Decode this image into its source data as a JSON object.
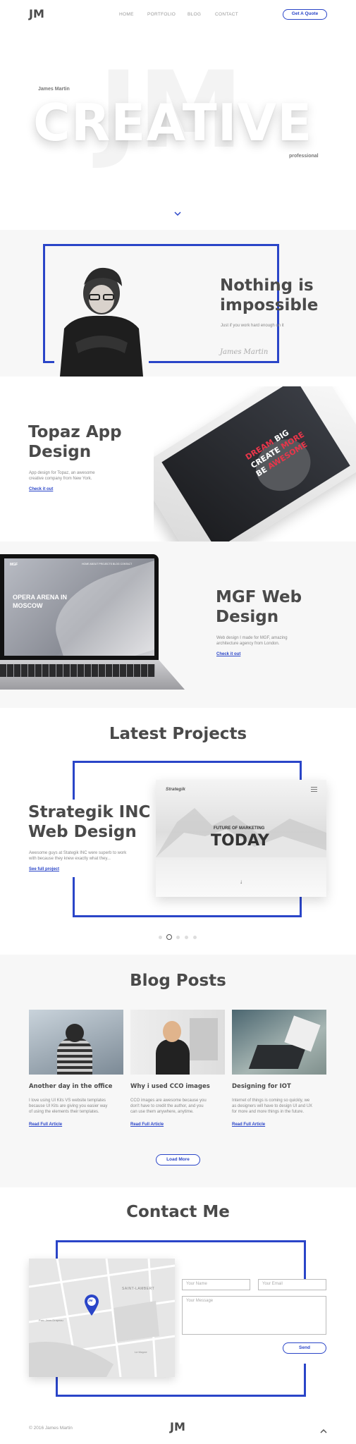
{
  "header": {
    "logo": "JM",
    "nav": [
      "HOME",
      "PORTFOLIO",
      "BLOG",
      "CONTACT"
    ],
    "cta": "Get A Quote"
  },
  "hero": {
    "name": "James Martin",
    "watermark": "JM",
    "title": "CREATIVE",
    "tagline": "professional"
  },
  "intro": {
    "heading_line1": "Nothing is",
    "heading_line2": "impossible",
    "text": "Just if you work hard enough on it",
    "signature": "James Martin"
  },
  "topaz": {
    "title_line1": "Topaz App",
    "title_line2": "Design",
    "desc_line1": "App design for Topaz, an awesome",
    "desc_line2": "creative company from New York.",
    "link": "Check it out",
    "phone_line1a": "DREAM ",
    "phone_line1b": "BIG",
    "phone_line2a": "CREATE ",
    "phone_line2b": "MORE",
    "phone_line3a": "BE ",
    "phone_line3b": "AWESOME"
  },
  "mgf": {
    "title_line1": "MGF Web",
    "title_line2": "Design",
    "desc_line1": "Web design I made for MGF, amazing",
    "desc_line2": "architecture agency from London.",
    "link": "Check it out",
    "screen_logo": "MGF",
    "screen_nav": "HOME  ABOUT  PROJECTS  BLOG  CONTACT",
    "screen_line1": "OPERA ARENA IN",
    "screen_line2": "MOSCOW"
  },
  "projects": {
    "heading": "Latest Projects",
    "title_line1": "Strategik INC",
    "title_line2": "Web Design",
    "desc_line1": "Awesome guys at Stategik INC were superb to work",
    "desc_line2": "with because they knew exactly what they...",
    "link": "See full project",
    "card_brand": "Strategik",
    "card_kicker": "FUTURE OF MARKETING",
    "card_title": "TODAY",
    "slides": 5,
    "active_slide": 2
  },
  "blog": {
    "heading": "Blog Posts",
    "posts": [
      {
        "title": "Another day in the office",
        "line1": "I love using UI Kits VS website templates",
        "line2": "because UI Kits are giving you easier way",
        "line3": "of using the elements their templates.",
        "link": "Read Full Article"
      },
      {
        "title": "Why i used CCO images",
        "line1": "CCO images are awesome because you",
        "line2": "don't have to credit the author, and you",
        "line3": "can use them anywhere, anytime.",
        "link": "Read Full Article"
      },
      {
        "title": "Designing for IOT",
        "line1": "Internet of things is coming so quickly, we",
        "line2": "as designers will have to design UI and UX",
        "line3": "for more and more things in the future.",
        "link": "Read Full Article"
      }
    ],
    "load_more": "Load More"
  },
  "contact": {
    "heading": "Contact Me",
    "name_placeholder": "Your Name",
    "email_placeholder": "Your Email",
    "message_placeholder": "Your Message",
    "send": "Send",
    "map_label1": "SAINT-LAMBERT",
    "map_label2": "Parc Jean-Drapeau",
    "map_label3": "Le Moyne",
    "map_pin": "JM"
  },
  "footer": {
    "copyright": "© 2016 James Martin",
    "logo": "JM"
  },
  "colors": {
    "accent": "#2a45c8",
    "text": "#4a4a4a",
    "red": "#e8364a"
  }
}
